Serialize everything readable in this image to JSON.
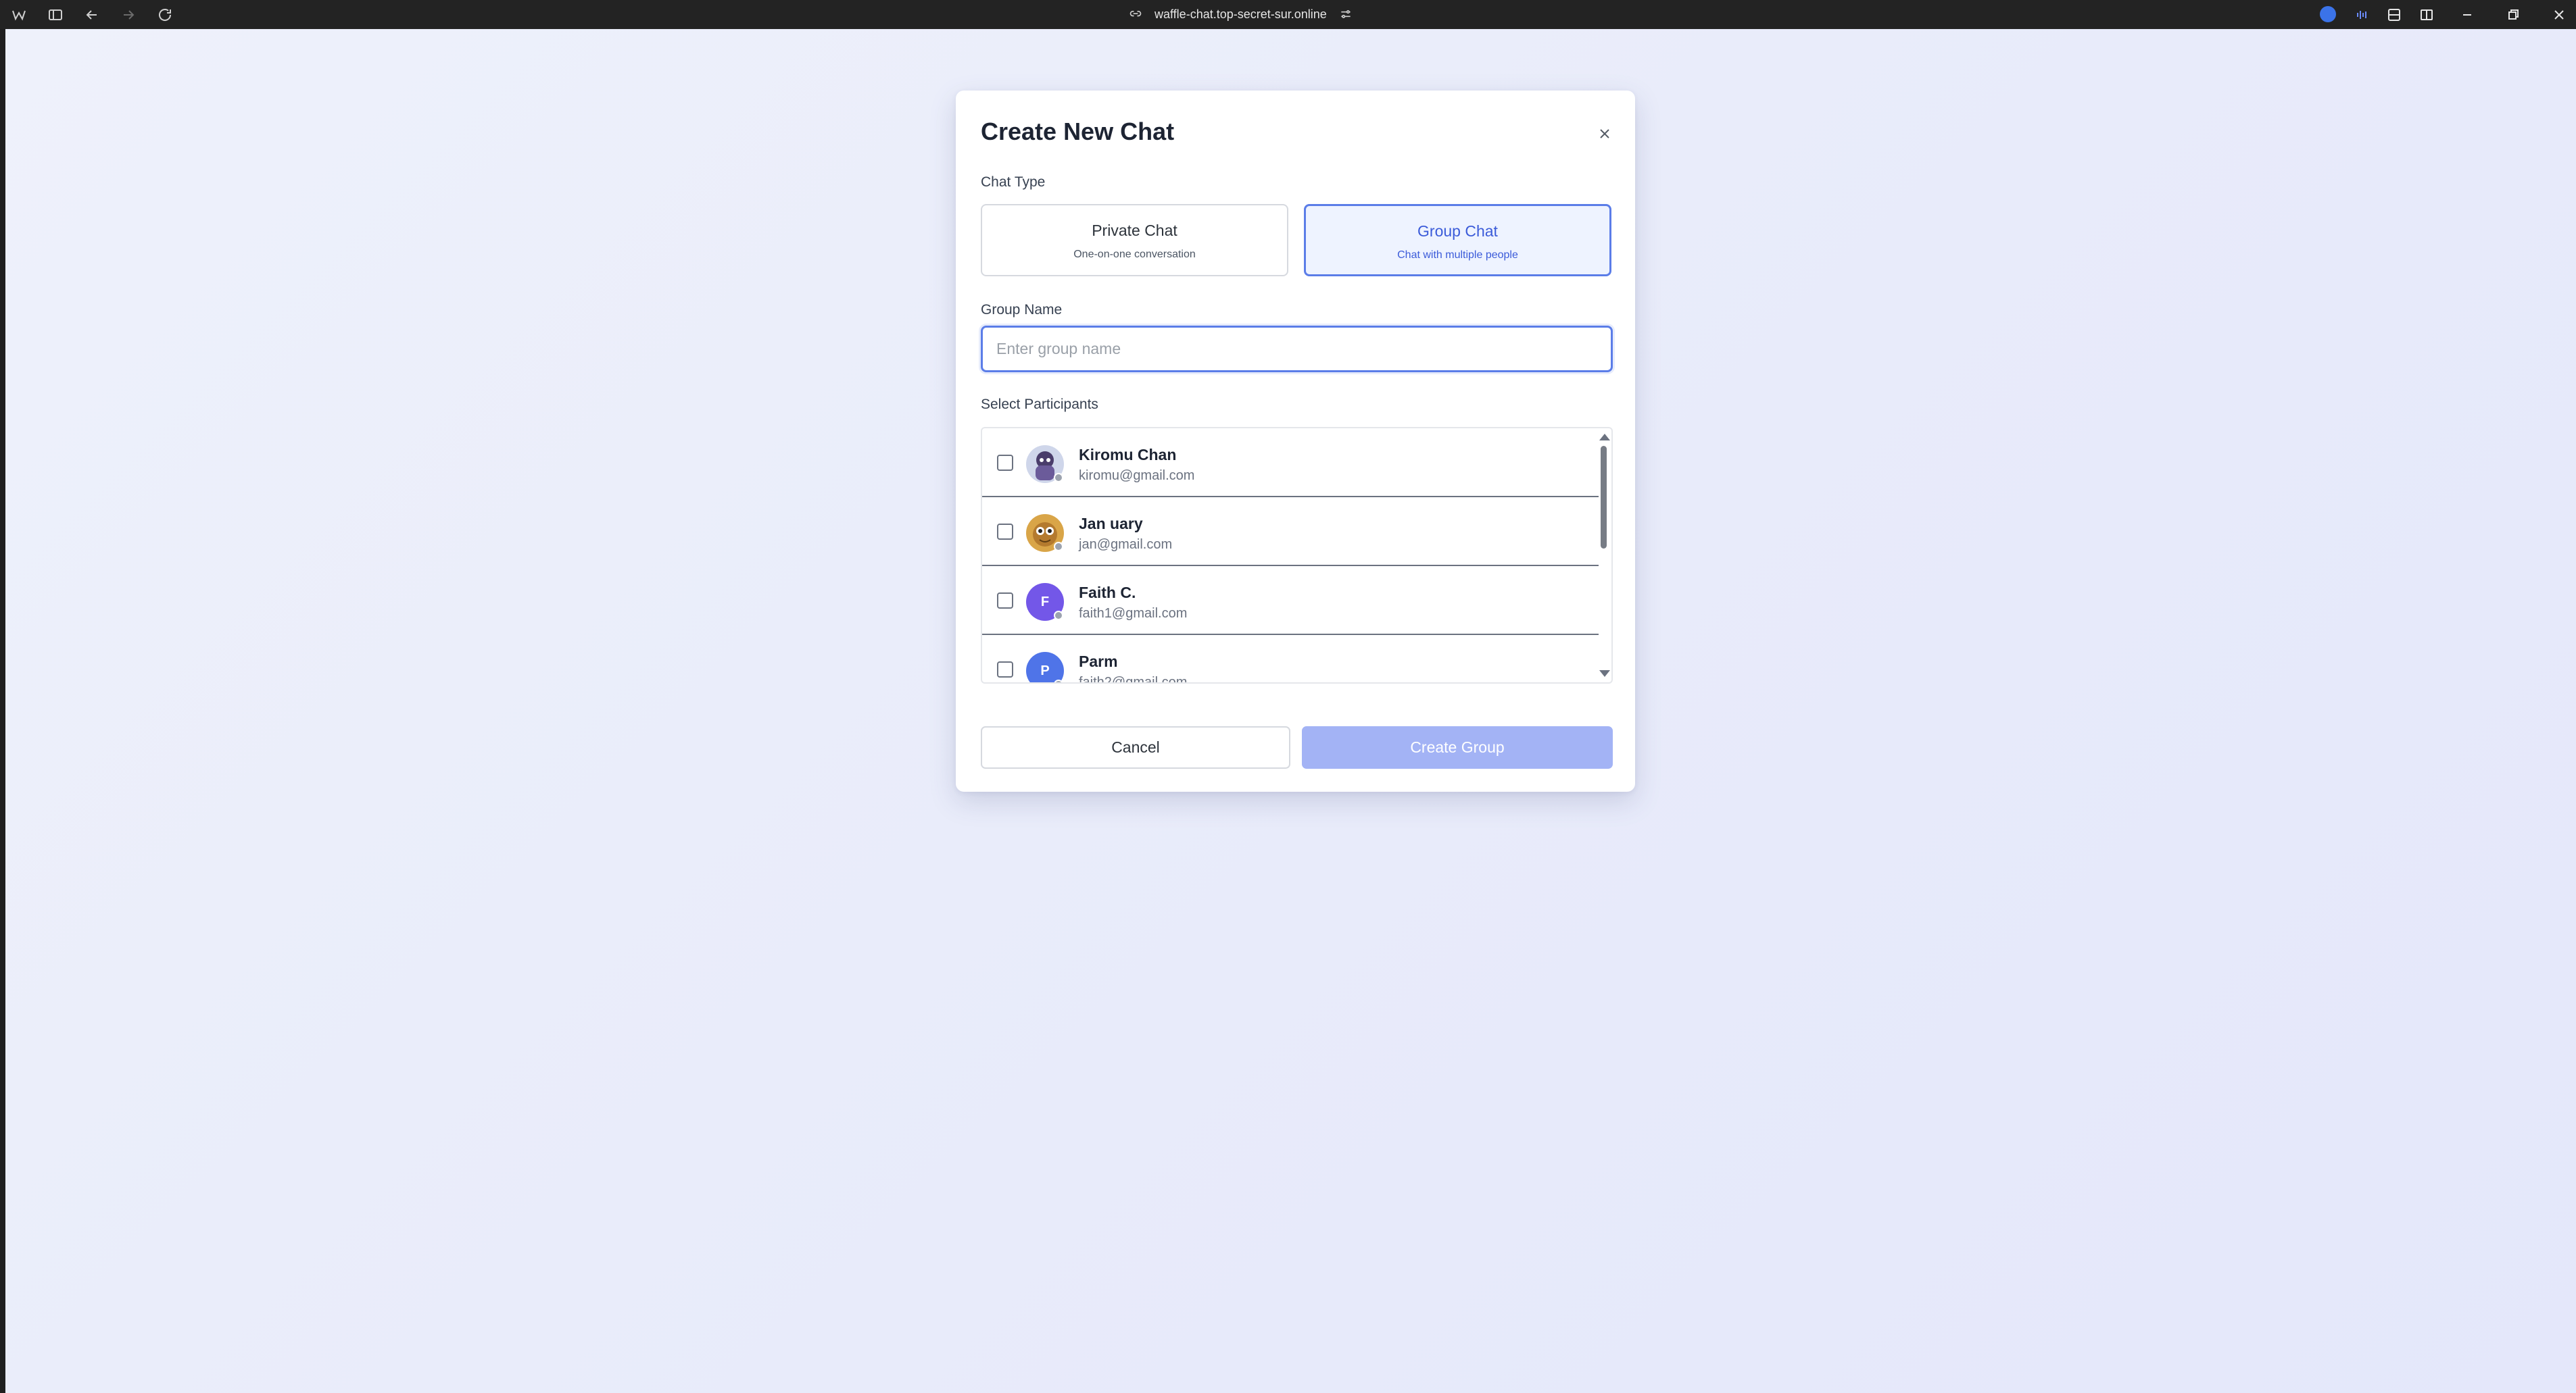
{
  "browser": {
    "url": "waffle-chat.top-secret-sur.online"
  },
  "modal": {
    "title": "Create New Chat",
    "chat_type_label": "Chat Type",
    "chat_types": [
      {
        "name": "Private Chat",
        "subtitle": "One-on-one conversation",
        "selected": false
      },
      {
        "name": "Group Chat",
        "subtitle": "Chat with multiple people",
        "selected": true
      }
    ],
    "group_name_label": "Group Name",
    "group_name_placeholder": "Enter group name",
    "group_name_value": "",
    "participants_label": "Select Participants",
    "participants": [
      {
        "name": "Kiromu Chan",
        "email": "kiromu@gmail.com",
        "avatar": "anime-character-avatar",
        "checked": false
      },
      {
        "name": "Jan uary",
        "email": "jan@gmail.com",
        "avatar": "cartoon-face-avatar",
        "checked": false
      },
      {
        "name": "Faith C.",
        "email": "faith1@gmail.com",
        "initial": "F",
        "avatar_color": "#7357e8",
        "checked": false
      },
      {
        "name": "Parm",
        "email": "faith2@gmail.com",
        "initial": "P",
        "avatar_color": "#4f74e8",
        "checked": false
      }
    ],
    "cancel_label": "Cancel",
    "create_label": "Create Group"
  },
  "colors": {
    "accent": "#5b7de8",
    "create_button_disabled": "#a3b3f5"
  }
}
